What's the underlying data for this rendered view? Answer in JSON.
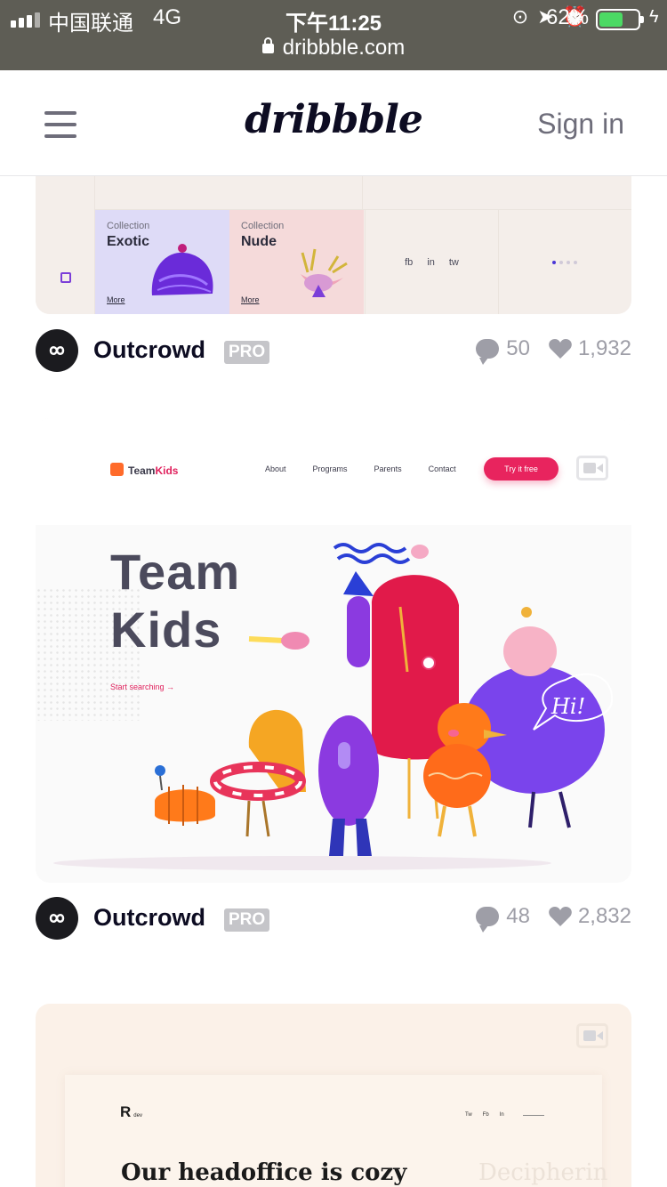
{
  "status_bar": {
    "carrier": "中国联通",
    "network": "4G",
    "time": "下午11:25",
    "battery_percent": "62%",
    "battery_level": 0.62
  },
  "browser": {
    "url": "dribbble.com"
  },
  "header": {
    "logo": "dribbble",
    "signin": "Sign in"
  },
  "shots": [
    {
      "author": "Outcrowd",
      "badge": "PRO",
      "comments": "50",
      "likes": "1,932",
      "preview": {
        "tiles": [
          {
            "caption": "Collection",
            "name": "Exotic",
            "more": "More"
          },
          {
            "caption": "Collection",
            "name": "Nude",
            "more": "More"
          }
        ],
        "social": [
          "fb",
          "in",
          "tw"
        ]
      }
    },
    {
      "author": "Outcrowd",
      "badge": "PRO",
      "comments": "48",
      "likes": "2,832",
      "preview": {
        "brand_a": "Team",
        "brand_b": "Kids",
        "nav": [
          "About",
          "Programs",
          "Parents",
          "Contact"
        ],
        "cta": "Try it free",
        "title_line1": "Team",
        "title_line2": "Kids",
        "search": "Start searching →",
        "speech": "Hi!"
      }
    },
    {
      "preview": {
        "logo": "R",
        "logo_sub": "dev",
        "social": [
          "Tw",
          "Fb",
          "In"
        ],
        "headline": "Our headoffice is cozy",
        "ghost": "Decipherin"
      }
    }
  ],
  "colors": {
    "accent_pink": "#e8245e",
    "text_dark": "#0d0c22",
    "text_muted": "#9e9ea7",
    "battery_green": "#4cd964"
  }
}
